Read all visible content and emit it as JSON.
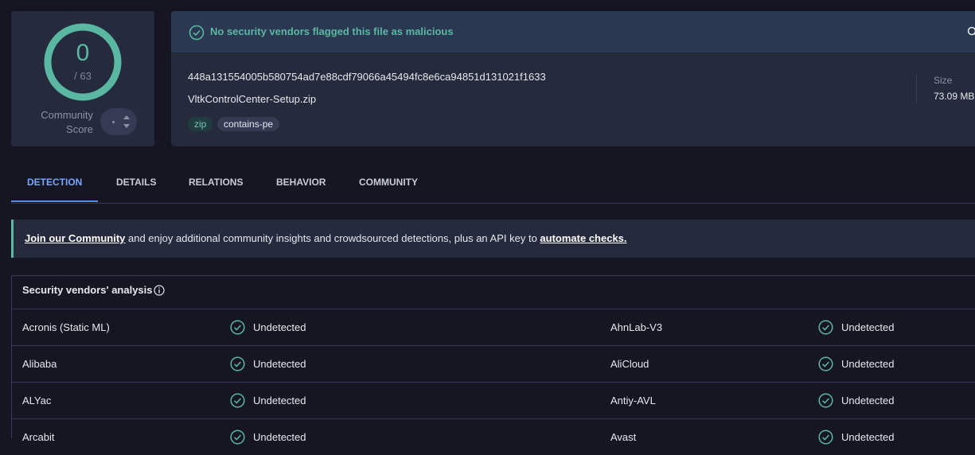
{
  "score": {
    "detected": "0",
    "total": "/ 63",
    "community_label_line1": "Community",
    "community_label_line2": "Score",
    "ring_color": "#5ab8a2"
  },
  "banner": {
    "message": "No security vendors flagged this file as malicious",
    "icon": "check-circle-icon",
    "accent": "#5ab8a2"
  },
  "file": {
    "hash": "448a131554005b580754ad7e88cdf79066a45494fc8e6ca94851d131021f1633",
    "name": "VltkControlCenter-Setup.zip",
    "tags": [
      "zip",
      "contains-pe"
    ],
    "size_label": "Size",
    "size_value": "73.09 MB"
  },
  "tabs": [
    {
      "label": "DETECTION",
      "active": true
    },
    {
      "label": "DETAILS",
      "active": false
    },
    {
      "label": "RELATIONS",
      "active": false
    },
    {
      "label": "BEHAVIOR",
      "active": false
    },
    {
      "label": "COMMUNITY",
      "active": false
    }
  ],
  "notice": {
    "link1": "Join our Community",
    "middle": " and enjoy additional community insights and crowdsourced detections, plus an API key to ",
    "link2": "automate checks."
  },
  "vendors": {
    "title": "Security vendors' analysis",
    "rows": [
      {
        "left": {
          "name": "Acronis (Static ML)",
          "status": "Undetected"
        },
        "right": {
          "name": "AhnLab-V3",
          "status": "Undetected"
        }
      },
      {
        "left": {
          "name": "Alibaba",
          "status": "Undetected"
        },
        "right": {
          "name": "AliCloud",
          "status": "Undetected"
        }
      },
      {
        "left": {
          "name": "ALYac",
          "status": "Undetected"
        },
        "right": {
          "name": "Antiy-AVL",
          "status": "Undetected"
        }
      },
      {
        "left": {
          "name": "Arcabit",
          "status": "Undetected"
        },
        "right": {
          "name": "Avast",
          "status": "Undetected"
        }
      }
    ]
  }
}
